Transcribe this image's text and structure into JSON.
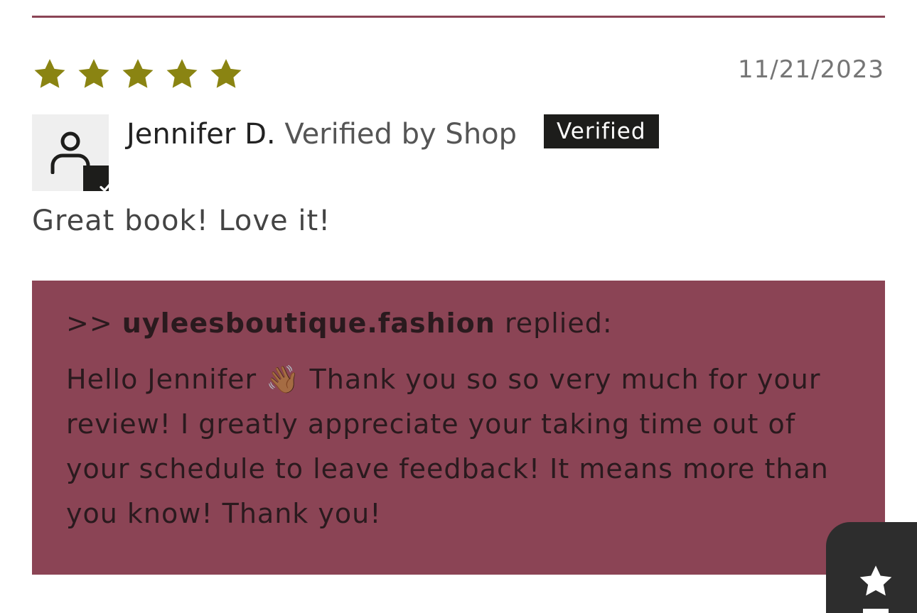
{
  "review": {
    "rating": 5,
    "max_rating": 5,
    "star_color": "#8a8412",
    "date": "11/21/2023",
    "author_name": "Jennifer D.",
    "verified_by_text": "Verified by Shop",
    "badge_label": "Verified",
    "body": "Great book! Love it!"
  },
  "reply": {
    "prefix": ">>",
    "shop_name": "uyleesboutique.fashion",
    "replied_label": "replied:",
    "message": "Hello Jennifer 👋🏾 Thank you so so very much for your review! I greatly appreciate your taking time out of your schedule to leave feedback! It means more than you know! Thank you!",
    "background_color": "#8b4455"
  },
  "icons": {
    "avatar": "user-icon",
    "verified_check": "check-icon",
    "reviews_widget": "star-icon"
  }
}
